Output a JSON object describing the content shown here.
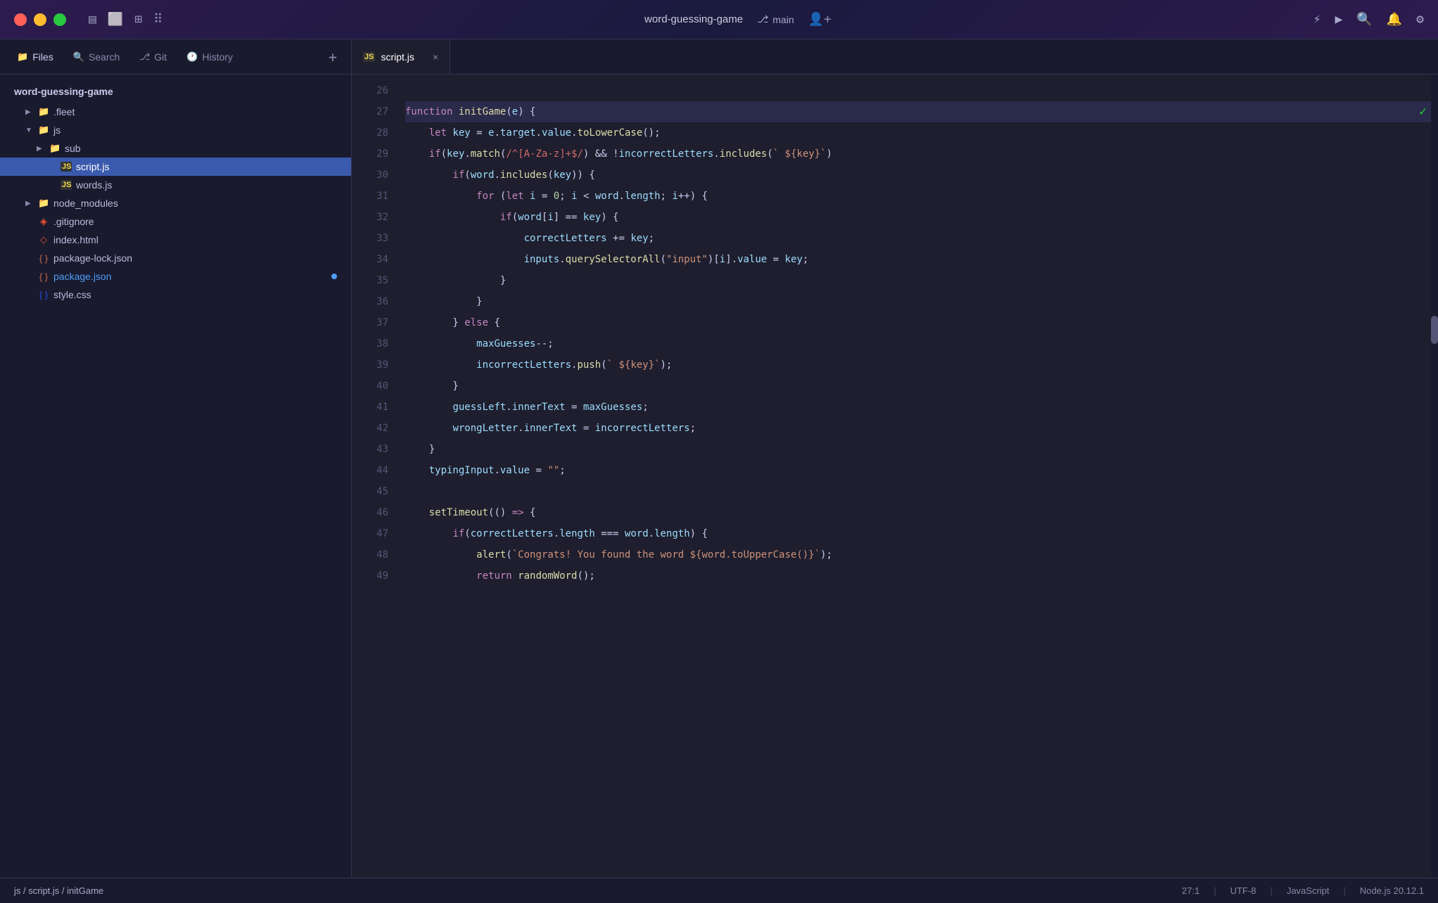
{
  "titlebar": {
    "project": "word-guessing-game",
    "branch": "main",
    "branch_icon": "⎇"
  },
  "sidebar": {
    "tabs": [
      {
        "id": "files",
        "label": "Files",
        "icon": "📁",
        "active": true
      },
      {
        "id": "search",
        "label": "Search",
        "icon": "🔍",
        "active": false
      },
      {
        "id": "git",
        "label": "Git",
        "icon": "⎇",
        "active": false
      },
      {
        "id": "history",
        "label": "History",
        "icon": "🕐",
        "active": false
      }
    ],
    "add_label": "+",
    "root": "word-guessing-game",
    "items": [
      {
        "id": "fleet",
        "label": ".fleet",
        "type": "folder",
        "indent": 1,
        "collapsed": true
      },
      {
        "id": "js",
        "label": "js",
        "type": "folder",
        "indent": 1,
        "collapsed": false
      },
      {
        "id": "sub",
        "label": "sub",
        "type": "folder",
        "indent": 2,
        "collapsed": true
      },
      {
        "id": "script-js",
        "label": "script.js",
        "type": "js",
        "indent": 3,
        "selected": true
      },
      {
        "id": "words-js",
        "label": "words.js",
        "type": "js",
        "indent": 3,
        "selected": false
      },
      {
        "id": "node_modules",
        "label": "node_modules",
        "type": "folder",
        "indent": 1,
        "collapsed": true
      },
      {
        "id": "gitignore",
        "label": ".gitignore",
        "type": "git",
        "indent": 1
      },
      {
        "id": "index-html",
        "label": "index.html",
        "type": "html",
        "indent": 1
      },
      {
        "id": "package-lock",
        "label": "package-lock.json",
        "type": "json",
        "indent": 1
      },
      {
        "id": "package-json",
        "label": "package.json",
        "type": "json",
        "indent": 1,
        "modified": true
      },
      {
        "id": "style-css",
        "label": "style.css",
        "type": "css",
        "indent": 1
      }
    ]
  },
  "editor": {
    "tabs": [
      {
        "id": "script-js",
        "label": "script.js",
        "type": "js",
        "active": true
      }
    ],
    "lines": [
      {
        "num": 26,
        "content": ""
      },
      {
        "num": 27,
        "content": "function initGame(e) {",
        "highlighted": true
      },
      {
        "num": 28,
        "content": "    let key = e.target.value.toLowerCase();"
      },
      {
        "num": 29,
        "content": "    if(key.match(/^[A-Za-z]+$/) && !incorrectLetters.includes(` ${key}`)"
      },
      {
        "num": 30,
        "content": "        if(word.includes(key)) {"
      },
      {
        "num": 31,
        "content": "            for (let i = 0; i < word.length; i++) {"
      },
      {
        "num": 32,
        "content": "                if(word[i] == key) {"
      },
      {
        "num": 33,
        "content": "                    correctLetters += key;"
      },
      {
        "num": 34,
        "content": "                    inputs.querySelectorAll(\"input\")[i].value = key;"
      },
      {
        "num": 35,
        "content": "                }"
      },
      {
        "num": 36,
        "content": "            }"
      },
      {
        "num": 37,
        "content": "        } else {"
      },
      {
        "num": 38,
        "content": "            maxGuesses--;"
      },
      {
        "num": 39,
        "content": "            incorrectLetters.push(` ${key}`);"
      },
      {
        "num": 40,
        "content": "        }"
      },
      {
        "num": 41,
        "content": "        guessLeft.innerText = maxGuesses;"
      },
      {
        "num": 42,
        "content": "        wrongLetter.innerText = incorrectLetters;"
      },
      {
        "num": 43,
        "content": "    }"
      },
      {
        "num": 44,
        "content": "    typingInput.value = \"\";"
      },
      {
        "num": 45,
        "content": ""
      },
      {
        "num": 46,
        "content": "    setTimeout(() => {"
      },
      {
        "num": 47,
        "content": "        if(correctLetters.length === word.length) {"
      },
      {
        "num": 48,
        "content": "            alert(`Congrats! You found the word ${word.toUpperCase()}`);"
      },
      {
        "num": 49,
        "content": "        return randomWord();"
      }
    ]
  },
  "statusbar": {
    "path": "js / script.js / initGame",
    "position": "27:1",
    "encoding": "UTF-8",
    "language": "JavaScript",
    "runtime": "Node.js 20.12.1"
  }
}
